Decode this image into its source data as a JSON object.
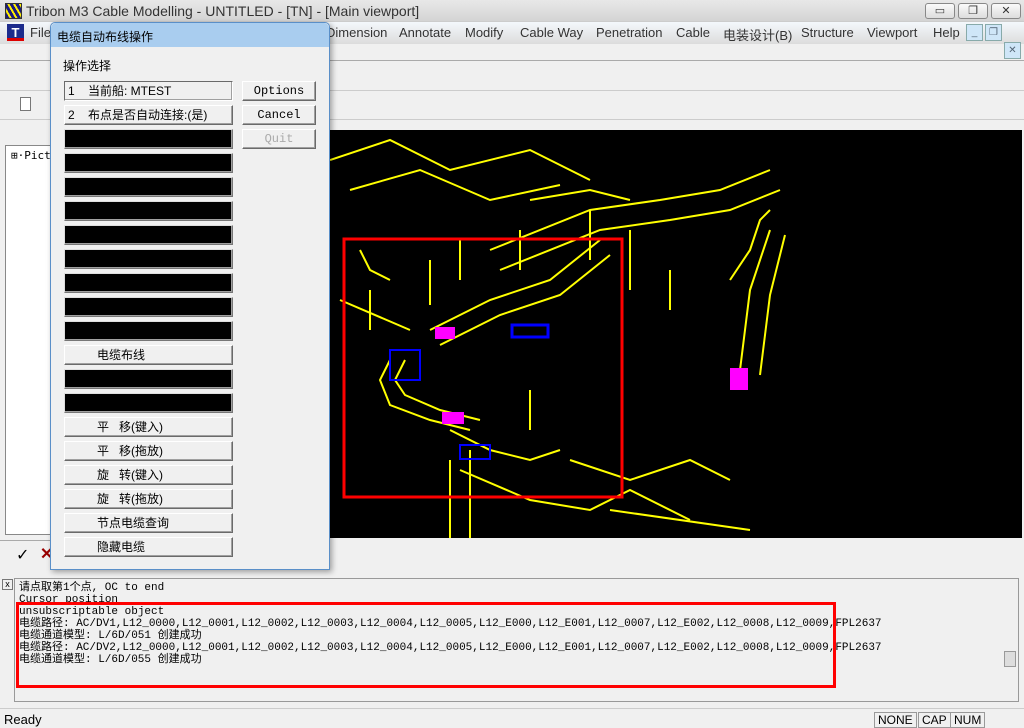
{
  "window": {
    "title": "Tribon M3 Cable Modelling - UNTITLED - [TN] - [Main viewport]",
    "minimize": "▭",
    "restore": "❐",
    "close": "✕"
  },
  "menu": [
    "File",
    "Dimension",
    "Annotate",
    "Modify",
    "Cable Way",
    "Penetration",
    "Cable",
    "电装设计(B)",
    "Structure",
    "Viewport",
    "Help"
  ],
  "tree": {
    "item": "Pict"
  },
  "dialog": {
    "title": "电缆自动布线操作",
    "group_label": "操作选择",
    "buttons": [
      "1    当前船: MTEST",
      "2    布点是否自动连接:(是)",
      "",
      "",
      "",
      "",
      "",
      "",
      "",
      "",
      "电缆布线",
      "",
      "",
      "平   移(键入)",
      "平   移(拖放)",
      "旋   转(键入)",
      "旋   转(拖放)",
      "节点电缆查询",
      "隐藏电缆"
    ],
    "options": "Options",
    "cancel": "Cancel",
    "quit": "Quit"
  },
  "output": {
    "lines": [
      "请点取第1个点, OC to end",
      "Cursor position",
      "unsubscriptable object",
      "电缆路径: AC/DV1,L12_0000,L12_0001,L12_0002,L12_0003,L12_0004,L12_0005,L12_E000,L12_E001,L12_0007,L12_E002,L12_0008,L12_0009,FPL2637",
      "电缆通道模型: L/6D/051 创建成功",
      "电缆路径: AC/DV2,L12_0000,L12_0001,L12_0002,L12_0003,L12_0004,L12_0005,L12_E000,L12_E001,L12_0007,L12_E002,L12_0008,L12_0009,FPL2637",
      "电缆通道模型: L/6D/055 创建成功"
    ]
  },
  "status": {
    "text": "Ready",
    "indicators": [
      "NONE",
      "CAP",
      "NUM"
    ]
  },
  "colors": {
    "highlight": "#ff0000",
    "model": "#ffff00",
    "selected": "#ff00ff",
    "cable": "#0000ff"
  }
}
